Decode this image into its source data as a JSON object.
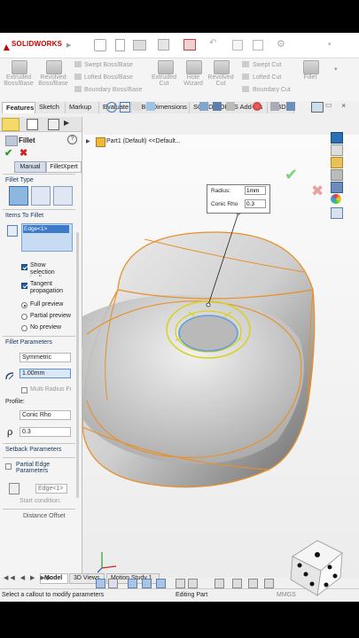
{
  "app": {
    "logo": "SOLIDWORKS"
  },
  "ribbon": {
    "items": [
      "Extruded Boss/Base",
      "Revolved Boss/Base",
      "Swept Boss/Base",
      "Lofted Boss/Base",
      "Boundary Boss/Base",
      "Extruded Cut",
      "Hole Wizard",
      "Revolved Cut",
      "Swept Cut",
      "Lofted Cut",
      "Boundary Cut",
      "Fillet"
    ]
  },
  "tabs": [
    "Features",
    "Sketch",
    "Markup",
    "Evaluate",
    "MBD Dimensions",
    "SOLIDWORKS Add-Ins",
    "MBD"
  ],
  "tree": {
    "part_label": "Part1 (Default) <<Default..."
  },
  "feature": {
    "title": "Fillet",
    "modes": [
      "Manual",
      "FilletXpert"
    ],
    "fillet_type_header": "Fillet Type",
    "items_header": "Items To Fillet",
    "selected_item": "Edge<1>",
    "options": {
      "show_selection_toolbar": "Show selection toolbar",
      "tangent_propagation": "Tangent propagation",
      "full_preview": "Full preview",
      "partial_preview": "Partial preview",
      "no_preview": "No preview"
    },
    "params_header": "Fillet Parameters",
    "param_method": "Symmetric",
    "radius_value": "1.00mm",
    "multi_radius": "Multi Radius Fillet",
    "profile_label": "Profile:",
    "profile_value": "Conic Rho",
    "rho_value": "0.3",
    "setback_header": "Setback Parameters",
    "partial_edge_header": "Partial Edge Parameters",
    "partial_edge_item": "Edge<1>",
    "start_condition": "Start condition:",
    "distance_offset": "Distance Offset"
  },
  "callout": {
    "radius_label": "Radius:",
    "radius_value": "1mm",
    "rho_label": "Conic Rho",
    "rho_value": "0.3"
  },
  "bottom_tabs": [
    "Model",
    "3D Views",
    "Motion Study 1"
  ],
  "status": {
    "left": "Select a callout to modify parameters",
    "center": "Editing Part",
    "units": "MMGS"
  }
}
